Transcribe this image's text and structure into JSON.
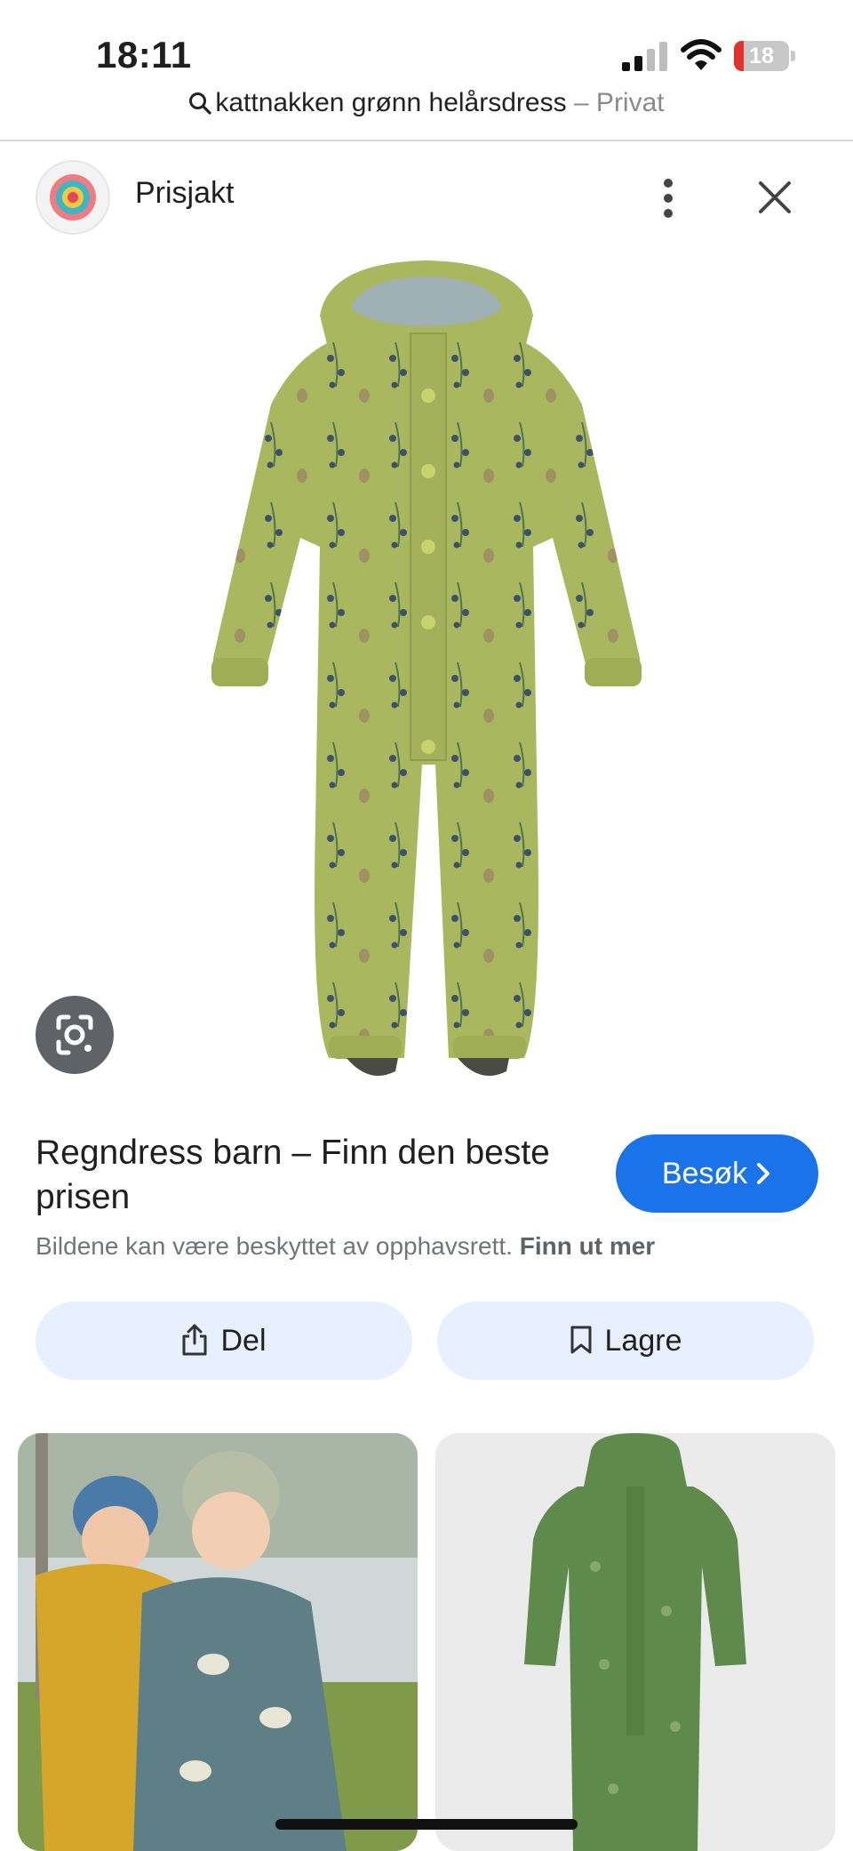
{
  "status_bar": {
    "time": "18:11",
    "battery_percent": 18
  },
  "url_bar": {
    "query": "kattnakken grønn helårsdress",
    "mode_suffix": " – Privat"
  },
  "source": {
    "name": "Prisjakt",
    "logo": "prisjakt-logo",
    "more_icon": "more-vert-icon",
    "close_icon": "close-icon"
  },
  "product": {
    "title": "Regndress barn – Finn den beste prisen",
    "visit_label": "Besøk",
    "copyright_notice": "Bildene kan være beskyttet av opphavsrett.",
    "learn_more_label": "Finn ut mer"
  },
  "actions": {
    "share_label": "Del",
    "save_label": "Lagre"
  },
  "colors": {
    "accent": "#1a73e8",
    "action_bg": "#e8efff",
    "suit_green": "#a9b85f"
  }
}
